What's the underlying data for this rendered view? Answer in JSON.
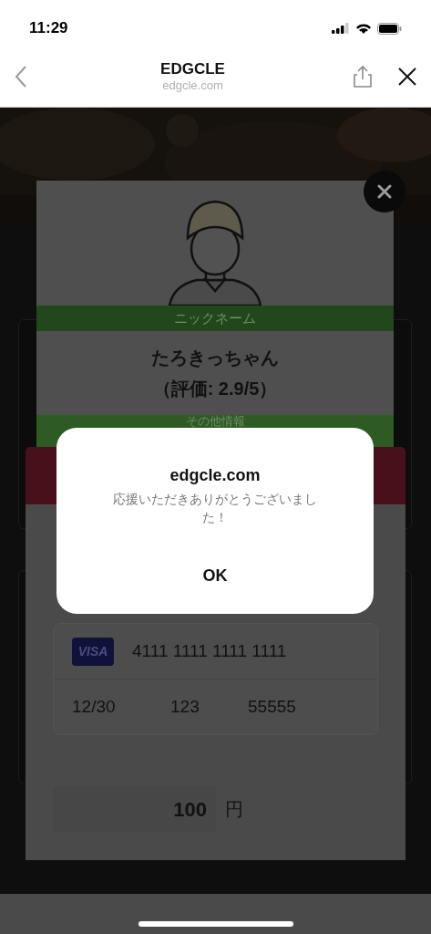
{
  "status_bar": {
    "time": "11:29"
  },
  "browser": {
    "title": "EDGCLE",
    "url": "edgcle.com"
  },
  "profile": {
    "nickname_label": "ニックネーム",
    "nickname": "たろきっちゃん",
    "rating": "（評価: 2.9/5）",
    "other_label": "その他情報"
  },
  "payment": {
    "card_brand": "VISA",
    "card_number": "4111 1111 1111 1111",
    "expiry": "12/30",
    "cvc": "123",
    "postal_code": "55555",
    "amount": "100",
    "currency": "円"
  },
  "alert": {
    "title": "edgcle.com",
    "message": "応援いただきありがとうございました！",
    "button": "OK"
  }
}
